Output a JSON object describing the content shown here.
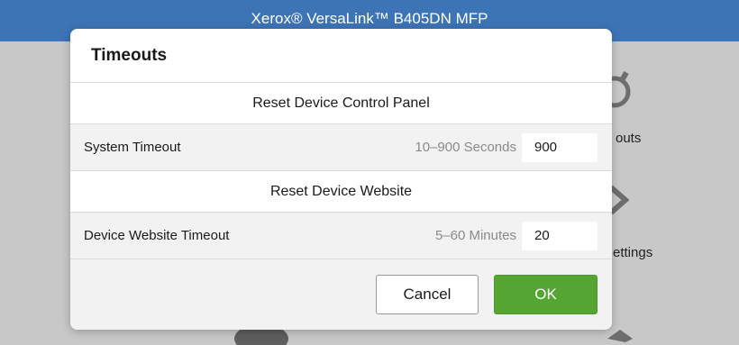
{
  "app": {
    "title": "Xerox® VersaLink™ B405DN MFP"
  },
  "background": {
    "tiles": [
      {
        "label": "outs",
        "icon": "timer-icon"
      },
      {
        "label": "ettings",
        "icon": "settings-chevron-icon"
      }
    ]
  },
  "dialog": {
    "title": "Timeouts",
    "sections": [
      {
        "header": "Reset Device Control Panel",
        "field": {
          "label": "System Timeout",
          "range": "10–900 Seconds",
          "value": "900"
        }
      },
      {
        "header": "Reset Device Website",
        "field": {
          "label": "Device Website Timeout",
          "range": "5–60 Minutes",
          "value": "20"
        }
      }
    ],
    "buttons": {
      "cancel": "Cancel",
      "ok": "OK"
    }
  },
  "colors": {
    "header": "#3d74b6",
    "ok_button": "#55a532"
  }
}
